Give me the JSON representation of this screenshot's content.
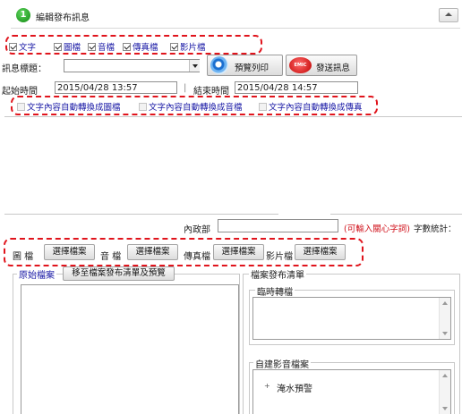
{
  "header": {
    "step": "1",
    "title": "編輯發布訊息"
  },
  "publish_types": [
    {
      "label": "文字",
      "checked": true
    },
    {
      "label": "圖檔",
      "checked": true
    },
    {
      "label": "音檔",
      "checked": true
    },
    {
      "label": "傳真檔",
      "checked": true
    },
    {
      "label": "影片檔",
      "checked": true
    }
  ],
  "message_title": {
    "label": "訊息標題：",
    "value": ""
  },
  "buttons": {
    "preview_print": "預覽列印",
    "send_message": "發送訊息",
    "send_badge": "EMIC"
  },
  "time": {
    "start_label": "起始時間",
    "start_value": "2015/04/28 13:57",
    "separator": "|",
    "end_label": "結束時間",
    "end_value": "2015/04/28 14:57"
  },
  "convert_options": [
    {
      "label": "文字內容自動轉換成圖檔",
      "checked": false
    },
    {
      "label": "文字內容自動轉換成音檔",
      "checked": false
    },
    {
      "label": "文字內容自動轉換成傳真",
      "checked": false
    }
  ],
  "content": {
    "label": "內政部",
    "value": "",
    "hint": "(可輸入關心字詞)",
    "count_label": "字數統計：",
    "count_value": ""
  },
  "file_uploads": [
    {
      "label": "圖 檔",
      "button": "選擇檔案"
    },
    {
      "label": "音 檔",
      "button": "選擇檔案"
    },
    {
      "label": "傳真檔",
      "button": "選擇檔案"
    },
    {
      "label": "影片檔",
      "button": "選擇檔案"
    }
  ],
  "original_files": {
    "label": "原始檔案",
    "move_button": "移至檔案發布清單及預覽"
  },
  "publish_list": {
    "title": "檔案發布清單",
    "temp_section": "臨時轉檔",
    "builtin_section": "自建影音檔案",
    "tree_items": [
      {
        "label": "淹水預警",
        "expand": "+"
      }
    ]
  },
  "colors": {
    "accent_red": "#e0141c",
    "link_blue": "#1a1aa6",
    "hint_red": "#d0101a"
  }
}
